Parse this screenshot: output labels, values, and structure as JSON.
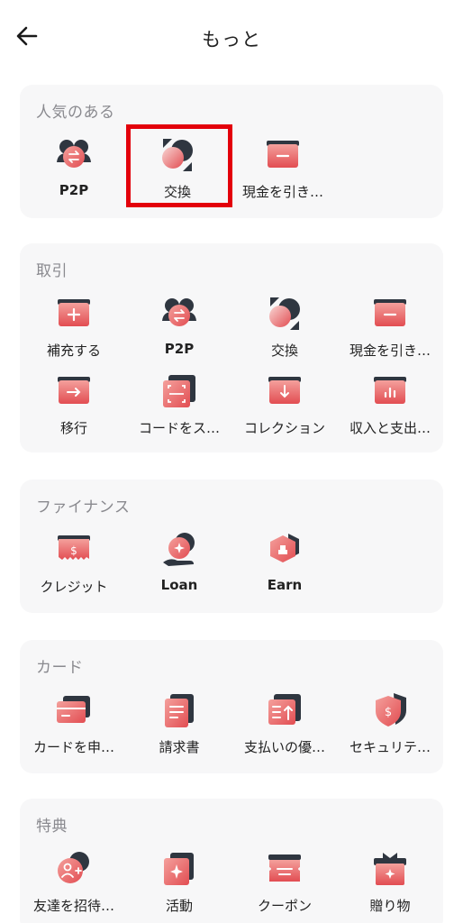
{
  "header": {
    "title": "もっと"
  },
  "sections": {
    "popular": {
      "title": "人気のある",
      "items": [
        {
          "label": "P2P",
          "icon": "p2p-icon"
        },
        {
          "label": "交換",
          "icon": "exchange-icon"
        },
        {
          "label": "現金を引き…",
          "icon": "withdraw-icon"
        }
      ]
    },
    "trade": {
      "title": "取引",
      "items": [
        {
          "label": "補充する",
          "icon": "deposit-icon"
        },
        {
          "label": "P2P",
          "icon": "p2p-icon"
        },
        {
          "label": "交換",
          "icon": "exchange-icon"
        },
        {
          "label": "現金を引き…",
          "icon": "withdraw-icon"
        },
        {
          "label": "移行",
          "icon": "transfer-icon"
        },
        {
          "label": "コードをス…",
          "icon": "scan-code-icon"
        },
        {
          "label": "コレクション",
          "icon": "collection-icon"
        },
        {
          "label": "収入と支出…",
          "icon": "income-expense-icon"
        }
      ]
    },
    "finance": {
      "title": "ファイナンス",
      "items": [
        {
          "label": "クレジット",
          "icon": "credit-icon"
        },
        {
          "label": "Loan",
          "icon": "loan-icon"
        },
        {
          "label": "Earn",
          "icon": "earn-icon"
        }
      ]
    },
    "card": {
      "title": "カード",
      "items": [
        {
          "label": "カードを申…",
          "icon": "card-apply-icon"
        },
        {
          "label": "請求書",
          "icon": "bill-icon"
        },
        {
          "label": "支払いの優…",
          "icon": "payment-priority-icon"
        },
        {
          "label": "セキュリテ…",
          "icon": "security-shield-icon"
        }
      ]
    },
    "benefits": {
      "title": "特典",
      "items": [
        {
          "label": "友達を招待…",
          "icon": "invite-friend-icon"
        },
        {
          "label": "活動",
          "icon": "activity-icon"
        },
        {
          "label": "クーポン",
          "icon": "coupon-icon"
        },
        {
          "label": "贈り物",
          "icon": "gift-icon"
        }
      ]
    }
  },
  "colors": {
    "accent": "#e8585a",
    "accent_light": "#f5c5c4",
    "dark": "#2f3640",
    "highlight": "#e3000b"
  }
}
